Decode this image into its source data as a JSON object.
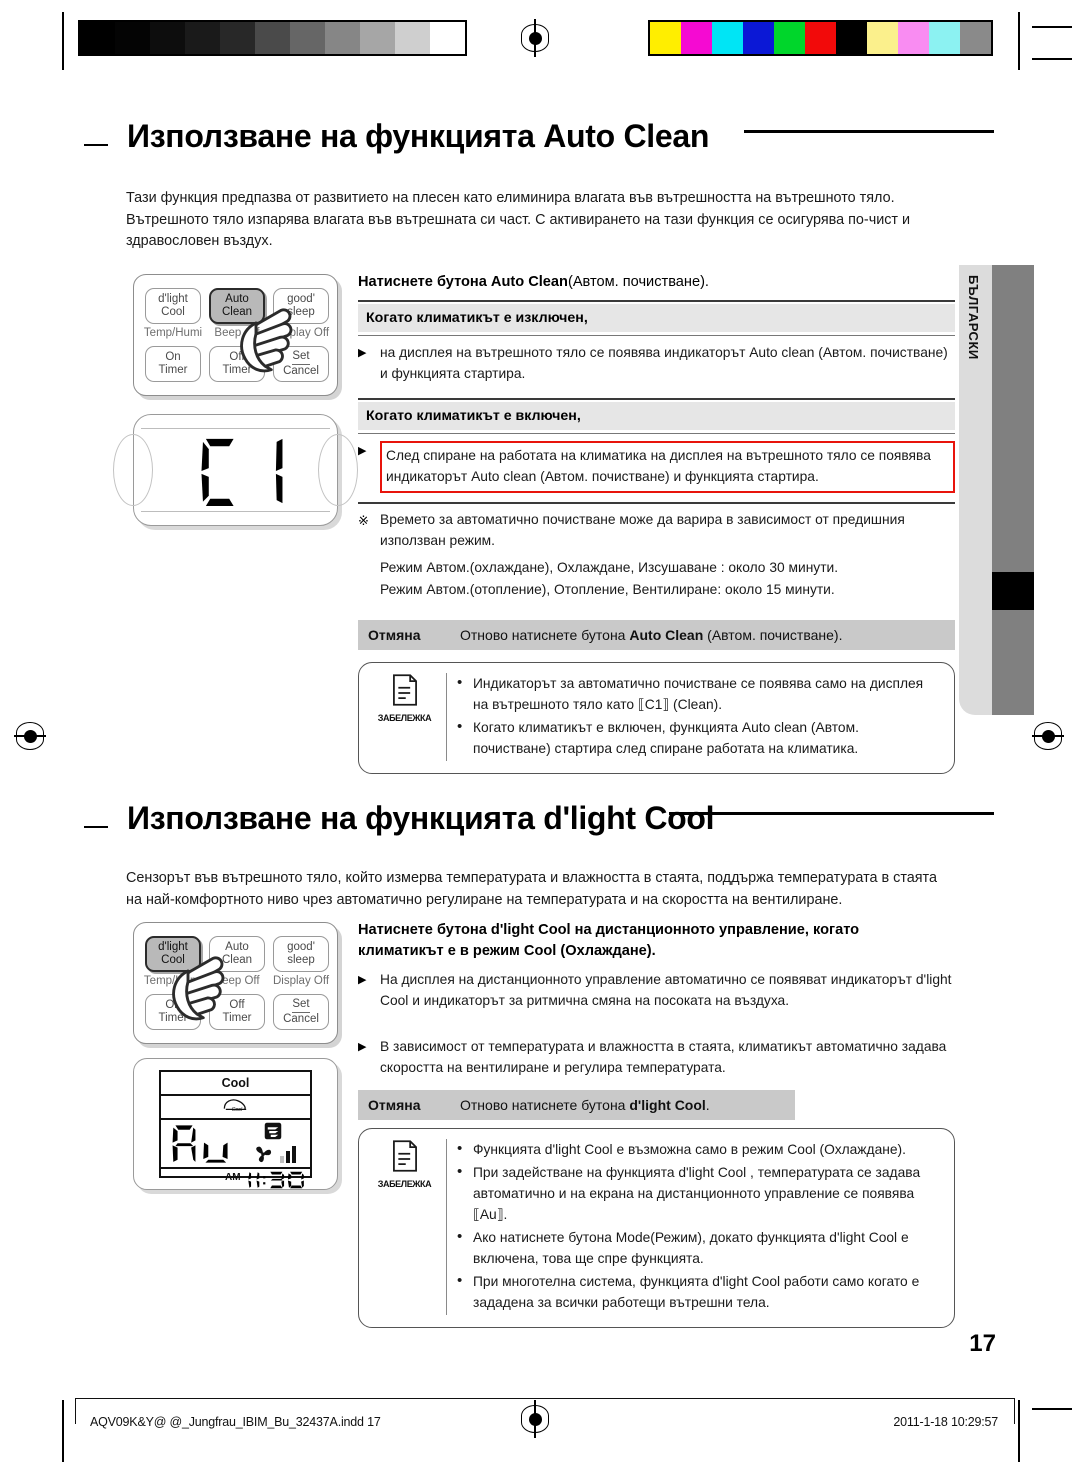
{
  "document": {
    "page_number": "17",
    "language_tab": "БЪЛГАРСКИ",
    "footer_file": "AQV09K&Y@ @_Jungfrau_IBIM_Bu_32437A.indd   17",
    "footer_date": "2011-1-18   10:29:57"
  },
  "calibration": {
    "grayscale": [
      "#000000",
      "#040404",
      "#0d0d0d",
      "#1a1a1a",
      "#282828",
      "#4a4a4a",
      "#666666",
      "#868686",
      "#a6a6a6",
      "#cfcfcf",
      "#ffffff"
    ],
    "colors": [
      "#ffee00",
      "#f50ad2",
      "#00e5f5",
      "#0b18d6",
      "#00d62b",
      "#f20a0a",
      "#000000",
      "#fbf08c",
      "#f98cf2",
      "#8cf2f2",
      "#8a8a8a"
    ]
  },
  "section1": {
    "title": "Използване на функцията Auto Clean",
    "intro": "Тази функция предпазва от развитието на плесен като елиминира влагата във вътрешността на вътрешното тяло. Вътрешното тяло изпарява влагата във вътрешната си част. С активирането на тази функция се осигурява по-чист и здравословен въздух.",
    "lead_bold": "Натиснете бутона Auto Clean",
    "lead_rest": "(Автом. почистване).",
    "band_off": "Когато климатикът е изключен,",
    "bullet_off": "на дисплея на вътрешното тяло се появява индикаторът Auto clean (Автом. почистване) и функцията стартира.",
    "band_on": "Когато климатикът е включен,",
    "bullet_on_red": "След спиране на работата на климатика на дисплея на вътрешното тяло се появява индикаторът Auto clean (Автом. почистване) и функцията стартира.",
    "note_star": "Времето за автоматично почистване може да варира в зависимост от предишния използван режим.",
    "timing_line1": "Режим Автом.(охлаждане), Охлаждане, Изсушаване : около 30 минути.",
    "timing_line2": "Режим Автом.(отопление), Отопление, Вентилиране:  около 15 минути.",
    "cancel_key": "Отмяна",
    "cancel_pre": "Отново натиснете бутона ",
    "cancel_bold": "Auto Clean",
    "cancel_post": " (Автом. почистване).",
    "note_label": "ЗАБЕЛЕЖКА",
    "note_items": [
      "Индикаторът за автоматично почистване се появява само на дисплея на вътрешното тяло като ⟦C1⟧ (Clean).",
      "Когато климатикът е включен, функцията Auto clean (Автом. почистване) стартира след спиране работата на климатика."
    ],
    "unit_display_value": "C1"
  },
  "section2": {
    "title": "Използване на функцията d'light Cool",
    "intro": "Сензорът във вътрешното тяло, който измерва температурата и влажността в стаята, поддържа температурата в стаята на най-комфортното ниво чрез автоматично регулиране на температурата и на скоростта на вентилиране.",
    "lead_line1_bold": "Натиснете бутона d'light Cool",
    "lead_line1_rest": " на дистанционното управление, когато",
    "lead_line2": "климатикът е в режим Cool (Охлаждане).",
    "bullet1": "На дисплея на дистанционното управление автоматично се появяват индикаторът d'light Cool и индикаторът за ритмична смяна на посоката на въздуха.",
    "bullet2": "В зависимост от температурата и влажността в стаята, климатикът автоматично задава скоростта на вентилиране и регулира температурата.",
    "cancel_key": "Отмяна",
    "cancel_pre": "Отново натиснете бутона ",
    "cancel_bold": "d'light Cool",
    "cancel_post": ".",
    "note_label": "ЗАБЕЛЕЖКА",
    "note_items": [
      "Функцията d'light Cool е възможна само в режим Cool (Охлаждане).",
      "При задействане на функцията d'light Cool , температурата се задава автоматично и на екрана на дистанционното управление се появява ⟦Au⟧.",
      "Ако натиснете бутона Mode(Режим), докато функцията d'light Cool е включена, това ще спре функцията.",
      "При многотелна система, функцията d'light Cool работи само когато е зададена за всички работещи вътрешни тела."
    ],
    "lcd": {
      "mode": "Cool",
      "value": "Au",
      "meridiem": "AM",
      "time": "11:30"
    }
  },
  "remote_keypad_1": {
    "keys": [
      {
        "line1": "d'light",
        "line2": "Cool",
        "pressed": false
      },
      {
        "line1": "Auto",
        "line2": "Clean",
        "pressed": true
      },
      {
        "line1": "good'",
        "line2": "sleep",
        "pressed": false
      },
      {
        "line1": "On",
        "line2": "Timer",
        "pressed": false
      },
      {
        "line1": "Off",
        "line2": "Timer",
        "pressed": false
      },
      {
        "line1": "Set",
        "line2": "Cancel",
        "pressed": false
      }
    ],
    "sublabels": [
      "Temp/Humi",
      "Beep Off",
      "Display Off"
    ]
  },
  "remote_keypad_2": {
    "keys": [
      {
        "line1": "d'light",
        "line2": "Cool",
        "pressed": true
      },
      {
        "line1": "Auto",
        "line2": "Clean",
        "pressed": false
      },
      {
        "line1": "good'",
        "line2": "sleep",
        "pressed": false
      },
      {
        "line1": "On",
        "line2": "Timer",
        "pressed": false
      },
      {
        "line1": "Off",
        "line2": "Timer",
        "pressed": false
      },
      {
        "line1": "Set",
        "line2": "Cancel",
        "pressed": false
      }
    ],
    "sublabels": [
      "Temp/Humi",
      "Beep Off",
      "Display Off"
    ]
  },
  "colors": {
    "highlight_red": "#e8140c",
    "band_light": "#e6e6e6",
    "band_dark": "#c9c9c9",
    "tab_gray": "#808080"
  }
}
